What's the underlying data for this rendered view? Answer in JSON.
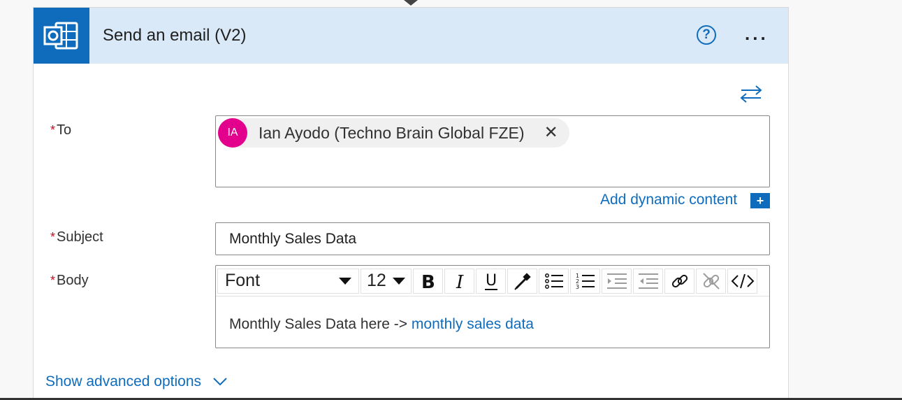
{
  "action": {
    "title": "Send an email (V2)",
    "help_label": "?",
    "more_label": "..."
  },
  "fields": {
    "to": {
      "label": "To",
      "required_mark": "*",
      "recipient": {
        "initials": "IA",
        "name": "Ian Ayodo (Techno Brain Global FZE)",
        "remove_label": "✕",
        "avatar_color": "#e3008c"
      }
    },
    "dynamic_content": {
      "label": "Add dynamic content",
      "plus": "+"
    },
    "subject": {
      "label": "Subject",
      "required_mark": "*",
      "value": "Monthly Sales Data"
    },
    "body": {
      "label": "Body",
      "required_mark": "*",
      "toolbar": {
        "font": "Font",
        "size": "12"
      },
      "text": "Monthly Sales Data here -> ",
      "dynamic_token": "monthly sales data"
    }
  },
  "footer": {
    "advanced_options": "Show advanced options"
  },
  "colors": {
    "accent": "#0f6cbd",
    "header_bg": "#d9e9f7",
    "required": "#c50f1f"
  },
  "icons": [
    "outlook-icon",
    "help-icon",
    "more-icon",
    "swap-icon",
    "bold-icon",
    "italic-icon",
    "underline-icon",
    "color-picker-icon",
    "bullet-list-icon",
    "numbered-list-icon",
    "decrease-indent-icon",
    "increase-indent-icon",
    "link-icon",
    "unlink-icon",
    "code-view-icon",
    "chevron-down-icon"
  ]
}
